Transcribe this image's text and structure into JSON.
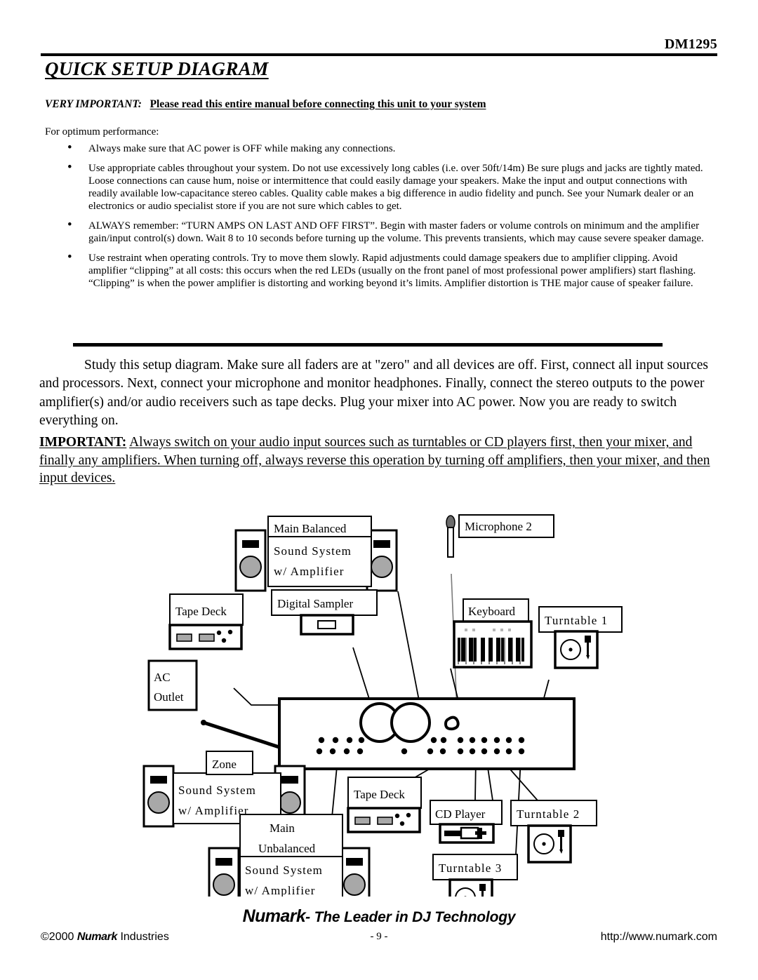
{
  "header": {
    "model": "DM1295",
    "section_title": "QUICK SETUP DIAGRAM"
  },
  "intro": {
    "very_important_label": "VERY IMPORTANT:",
    "very_important_body": "Please read this entire manual before connecting this unit to your system",
    "for_optimum": "For optimum performance:",
    "bullets": [
      "Always make sure that AC power is OFF while making any connections.",
      "Use appropriate cables throughout your system. Do not use excessively long cables (i.e. over 50ft/14m) Be sure plugs and jacks are tightly mated. Loose connections can cause hum, noise or intermittence that could easily damage your speakers. Make the input and output connections with readily available low-capacitance stereo cables. Quality cable makes a big difference in audio fidelity and punch. See your Numark dealer or an electronics or audio specialist store if you are not sure which cables to get.",
      "ALWAYS remember: “TURN AMPS ON LAST AND OFF FIRST”. Begin with master faders or volume controls on minimum and the amplifier gain/input control(s) down. Wait 8 to 10 seconds before turning up the volume. This prevents transients, which may cause severe speaker damage.",
      "Use restraint when operating controls. Try to move them slowly. Rapid adjustments could damage speakers due to amplifier clipping. Avoid amplifier “clipping” at all costs: this occurs when the red LEDs (usually on the front panel of most professional power amplifiers) start flashing. “Clipping” is when the power amplifier is distorting and working beyond it’s limits. Amplifier distortion is THE major cause of speaker failure."
    ]
  },
  "body": {
    "study_paragraph": "Study this setup diagram. Make sure all faders are at \"zero\" and all devices are off. First, connect all input sources and processors. Next, connect your microphone and monitor headphones. Finally, connect the stereo outputs to the power amplifier(s) and/or audio receivers such as tape decks. Plug your mixer into AC power. Now you are ready to switch everything on.",
    "important_label": "IMPORTANT:",
    "important_body": "Always switch on your audio input sources such as turntables or CD players first, then your mixer, and finally any amplifiers.  When turning off, always reverse this operation by turning off amplifiers, then your mixer, and then input devices."
  },
  "diagram": {
    "main_balanced": {
      "line1": "Main Balanced",
      "line2": "Sound System",
      "line3": "w/ Amplifier"
    },
    "zone": {
      "title": "Zone",
      "line2": "Sound System",
      "line3": "w/ Amplifier"
    },
    "main_unbalanced": {
      "line1": "Main",
      "line2": "Unbalanced",
      "line3": "Sound System",
      "line4": "w/ Amplifier"
    },
    "tape_deck_top": "Tape Deck",
    "tape_deck_bottom": "Tape Deck",
    "digital_sampler": "Digital Sampler",
    "ac_outlet_line1": "AC",
    "ac_outlet_line2": "Outlet",
    "microphone": "Microphone 2",
    "keyboard": "Keyboard",
    "turntable_1": "Turntable 1",
    "turntable_2": "Turntable 2",
    "turntable_3": "Turntable 3",
    "cd_player": "CD Player"
  },
  "footer": {
    "brand": "Numark",
    "tagline": "- The Leader in DJ Technology",
    "copyright_prefix": "©2000 ",
    "copyright_brand": "Numark",
    "copyright_suffix": " Industries",
    "page_number": "- 9 -",
    "url": "http://www.numark.com"
  }
}
